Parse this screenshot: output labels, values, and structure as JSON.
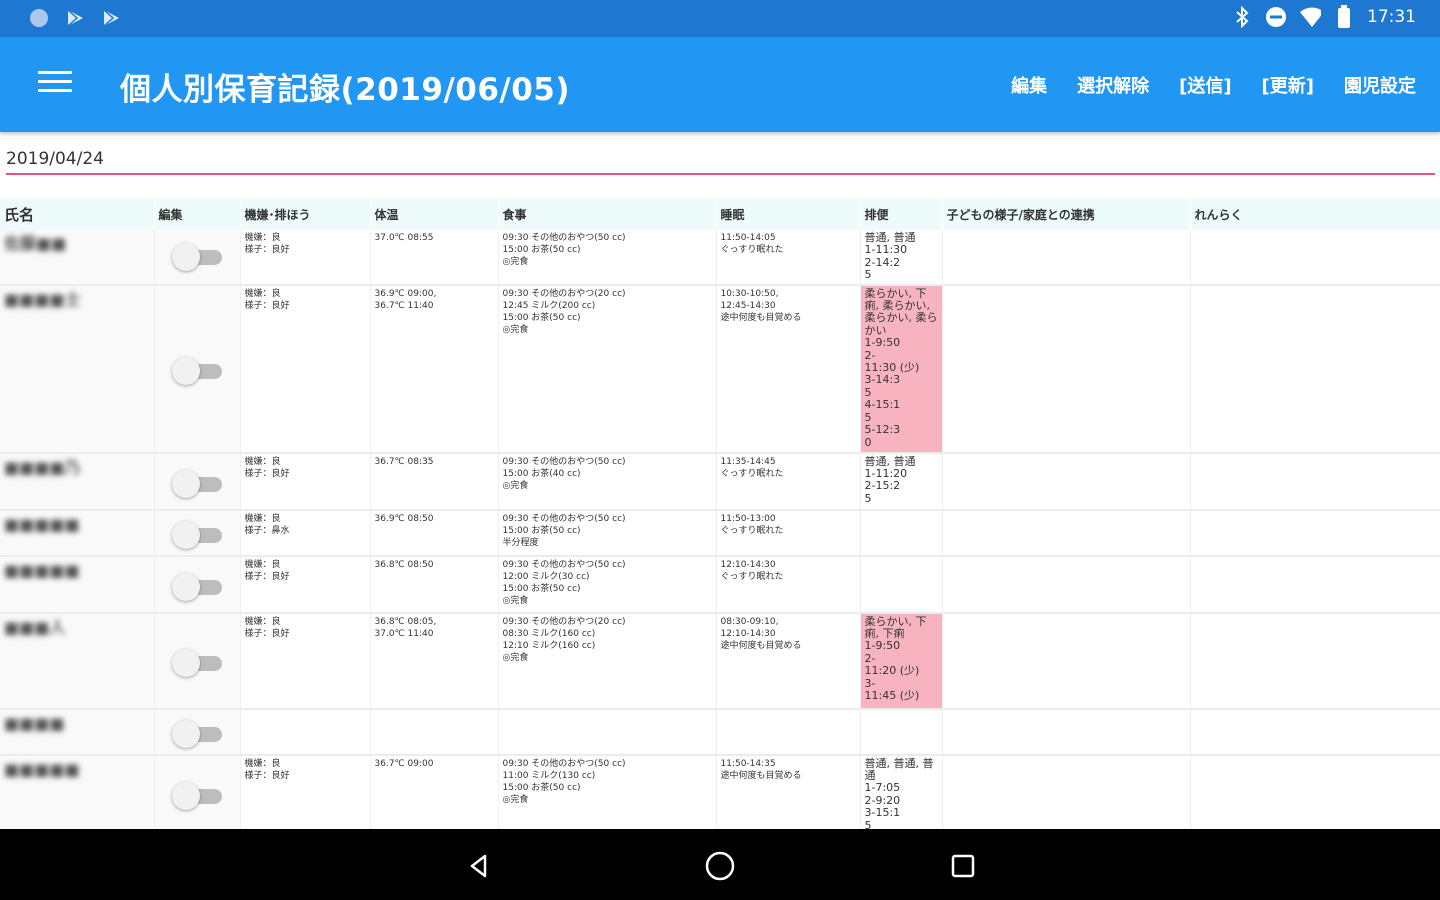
{
  "status_bar": {
    "time": "17:31",
    "left_icons": [
      "circle-notification-icon",
      "play-store-icon",
      "play-store-icon"
    ],
    "right_icons": [
      "bluetooth-icon",
      "do-not-disturb-icon",
      "wifi-icon",
      "battery-icon"
    ]
  },
  "app_bar": {
    "title": "個人別保育記録(2019/06/05)",
    "actions": [
      "編集",
      "選択解除",
      "[送信]",
      "[更新]",
      "園児設定"
    ]
  },
  "date_field": {
    "value": "2019/04/24"
  },
  "table": {
    "headers": [
      "氏名",
      "編集",
      "機嫌･排ほう",
      "体温",
      "食事",
      "睡眠",
      "排便",
      "子どもの様子/家庭との連携",
      "れんらく"
    ],
    "rows": [
      {
        "name": "佐藤■■",
        "edit": false,
        "mood": "機嫌：良\n様子：良好",
        "temp": "37.0℃ 08:55",
        "meal": "09:30 その他のおやつ(50 cc)\n15:00 お茶(50 cc)\n◎完食",
        "sleep": "11:50-14:05\nぐっすり眠れた",
        "stool": "普通, 普通\n1-11:30\n2-14:2\n5",
        "stool_highlight": false,
        "notes": "",
        "contact": ""
      },
      {
        "name": "■■■■士",
        "edit": false,
        "mood": "機嫌：良\n様子：良好",
        "temp": "36.9℃ 09:00,\n36.7℃ 11:40",
        "meal": "09:30 その他のおやつ(20 cc)\n12:45 ミルク(200 cc)\n15:00 お茶(50 cc)\n◎完食",
        "sleep": "10:30-10:50,\n12:45-14:30\n途中何度も目覚める",
        "stool": "柔らかい, 下\n痢, 柔らかい,\n柔らかい, 柔ら\nかい\n1-9:50\n2-\n11:30 (少)\n3-14:3\n5\n4-15:1\n5\n5-12:3\n0",
        "stool_highlight": true,
        "notes": "",
        "contact": ""
      },
      {
        "name": "■■■■乃",
        "edit": false,
        "mood": "機嫌：良\n様子：良好",
        "temp": "36.7℃ 08:35",
        "meal": "09:30 その他のおやつ(50 cc)\n15:00 お茶(40 cc)\n◎完食",
        "sleep": "11:35-14:45\nぐっすり眠れた",
        "stool": "普通, 普通\n1-11:20\n2-15:2\n5",
        "stool_highlight": false,
        "notes": "",
        "contact": ""
      },
      {
        "name": "■■■■■",
        "edit": false,
        "mood": "機嫌：良\n様子：鼻水",
        "temp": "36.9℃ 08:50",
        "meal": "09:30 その他のおやつ(50 cc)\n15:00 お茶(50 cc)\n半分程度",
        "sleep": "11:50-13:00\nぐっすり眠れた",
        "stool": "",
        "stool_highlight": false,
        "notes": "",
        "contact": ""
      },
      {
        "name": "■■■■■",
        "edit": false,
        "mood": "機嫌：良\n様子：良好",
        "temp": "36.8℃ 08:50",
        "meal": "09:30 その他のおやつ(50 cc)\n12:00 ミルク(30 cc)\n15:00 お茶(50 cc)\n◎完食",
        "sleep": "12:10-14:30\nぐっすり眠れた",
        "stool": "",
        "stool_highlight": false,
        "notes": "",
        "contact": ""
      },
      {
        "name": "■■■人",
        "edit": false,
        "mood": "機嫌：良\n様子：良好",
        "temp": "36.8℃ 08:05,\n37.0℃ 11:40",
        "meal": "09:30 その他のおやつ(20 cc)\n08:30 ミルク(160 cc)\n12:10 ミルク(160 cc)\n◎完食",
        "sleep": "08:30-09:10,\n12:10-14:30\n途中何度も目覚める",
        "stool": "柔らかい, 下\n痢, 下痢\n1-9:50\n2-\n11:20 (少)\n3-\n11:45 (少)",
        "stool_highlight": true,
        "notes": "",
        "contact": ""
      },
      {
        "name": "■■■■",
        "edit": false,
        "mood": "",
        "temp": "",
        "meal": "",
        "sleep": "",
        "stool": "",
        "stool_highlight": false,
        "notes": "",
        "contact": ""
      },
      {
        "name": "■■■■■",
        "edit": false,
        "mood": "機嫌：良\n様子：良好",
        "temp": "36.7℃ 09:00",
        "meal": "09:30 その他のおやつ(50 cc)\n11:00 ミルク(130 cc)\n15:00 お茶(50 cc)\n◎完食",
        "sleep": "11:50-14:35\n途中何度も目覚める",
        "stool": "普通, 普通, 普\n通\n1-7:05\n2-9:20\n3-15:1\n5",
        "stool_highlight": false,
        "notes": "",
        "contact": ""
      }
    ]
  },
  "nav_bar": {
    "buttons": [
      "back-icon",
      "home-icon",
      "recents-icon"
    ]
  },
  "colors": {
    "status_bar": "#1e78d2",
    "app_bar": "#2196f3",
    "accent_line": "#e5537e",
    "stool_alert": "#f8b3c1",
    "header_row": "#eefbfb"
  }
}
